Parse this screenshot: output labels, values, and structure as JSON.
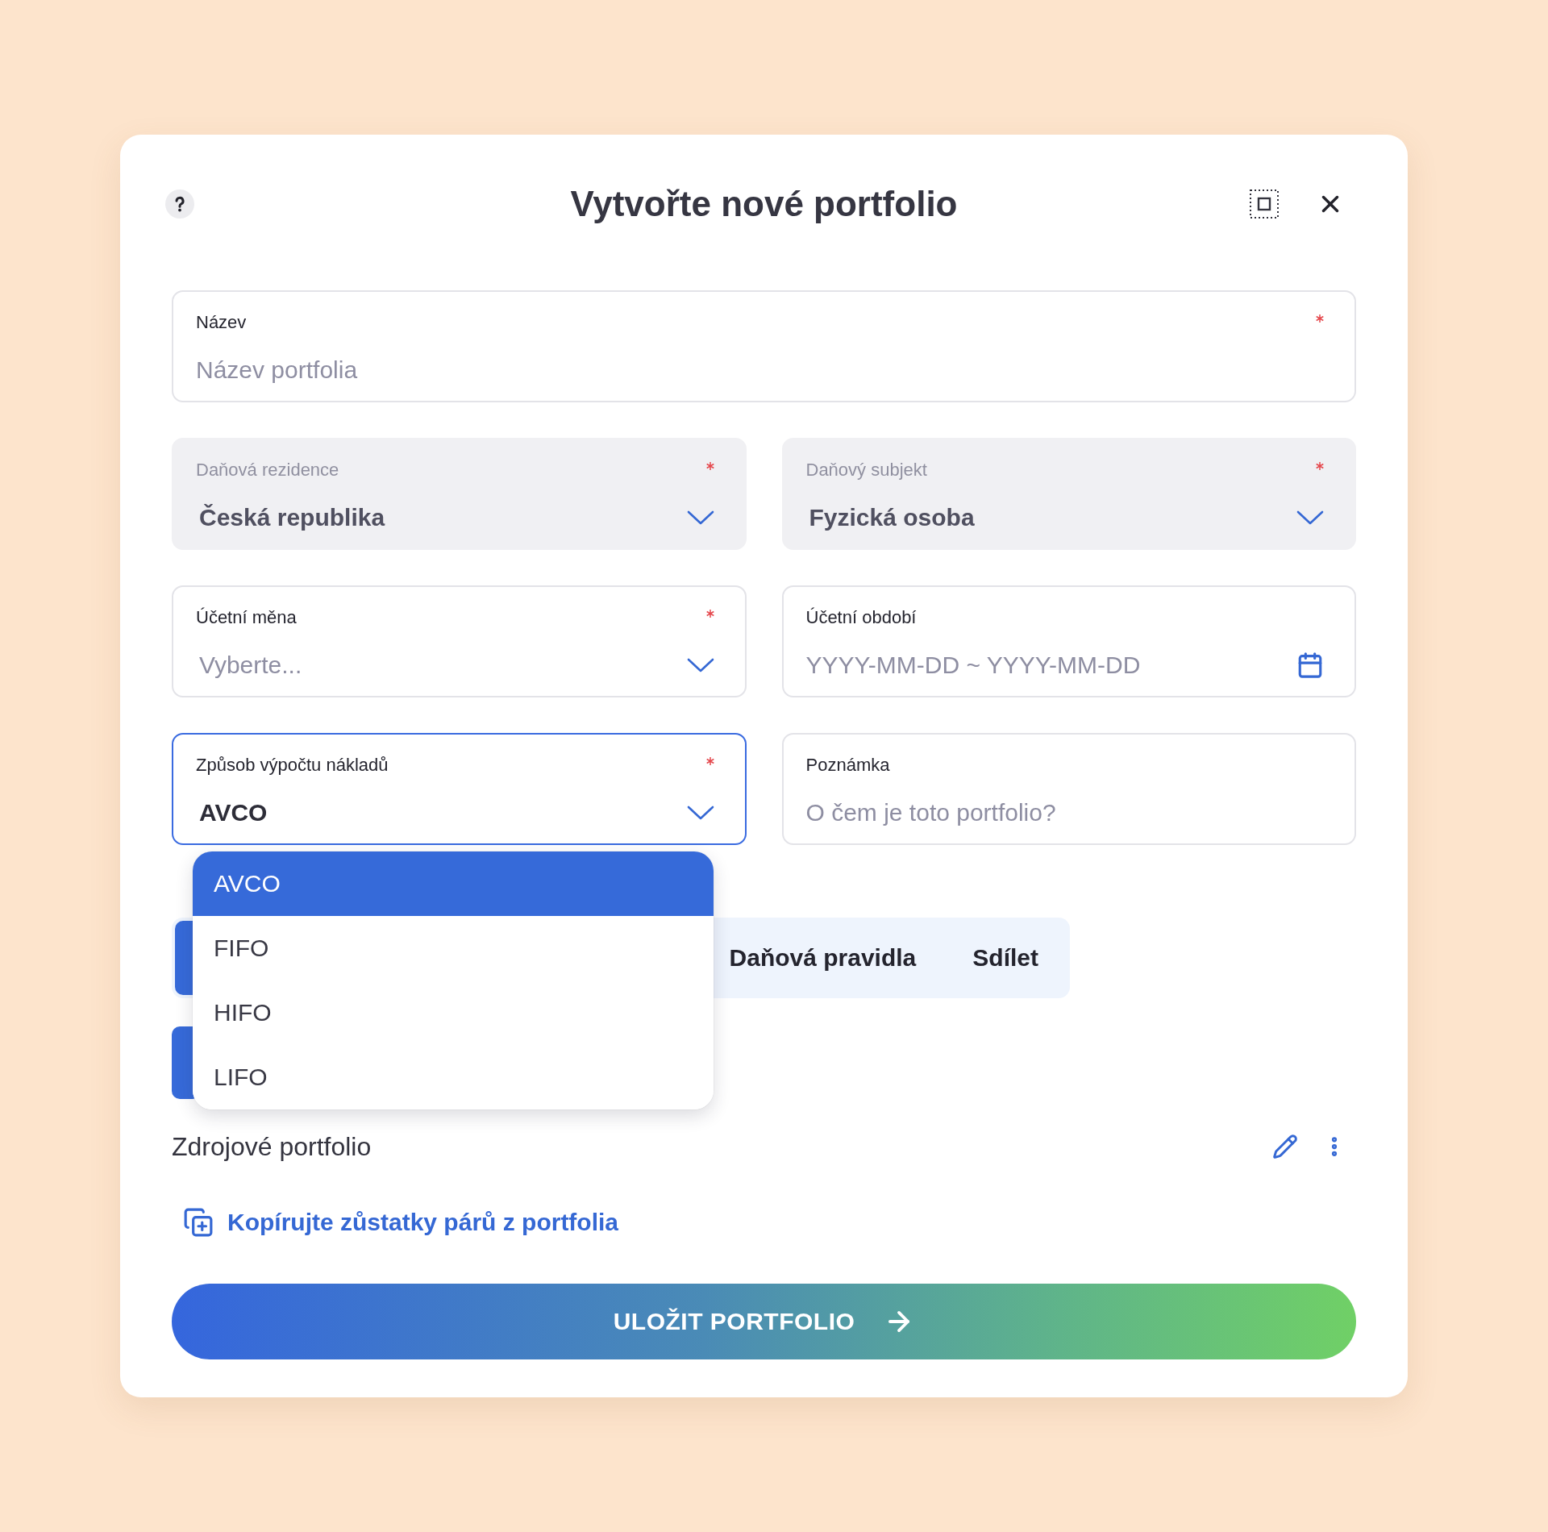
{
  "dialog": {
    "title": "Vytvořte nové portfolio"
  },
  "field_rows": [
    [
      {
        "kind": "text",
        "label": "Název",
        "placeholder": "Název portfolia",
        "required": true,
        "disabled": false,
        "focused": false
      }
    ],
    [
      {
        "kind": "select",
        "label": "Daňová rezidence",
        "value": "Česká republika",
        "required": true,
        "disabled": true,
        "focused": false,
        "expanded": false
      },
      {
        "kind": "select",
        "label": "Daňový subjekt",
        "value": "Fyzická osoba",
        "required": true,
        "disabled": true,
        "focused": false,
        "expanded": false
      }
    ],
    [
      {
        "kind": "select",
        "label": "Účetní měna",
        "placeholder": "Vyberte...",
        "required": true,
        "disabled": false,
        "focused": false,
        "expanded": false
      },
      {
        "kind": "date_range",
        "label": "Účetní období",
        "placeholder": "YYYY-MM-DD ~ YYYY-MM-DD",
        "required": false,
        "disabled": false,
        "focused": false
      }
    ],
    [
      {
        "kind": "select",
        "label": "Způsob výpočtu nákladů",
        "value": "AVCO",
        "required": true,
        "disabled": false,
        "focused": true,
        "expanded": true,
        "options": [
          {
            "label": "AVCO",
            "selected": true
          },
          {
            "label": "FIFO",
            "selected": false
          },
          {
            "label": "HIFO",
            "selected": false
          },
          {
            "label": "LIFO",
            "selected": false
          }
        ]
      },
      {
        "kind": "text",
        "label": "Poznámka",
        "placeholder": "O čem je toto portfolio?",
        "required": false,
        "disabled": false,
        "focused": false
      }
    ]
  ],
  "tabs": [
    {
      "selected": true
    },
    {
      "label": "Daňová pravidla",
      "selected": false
    },
    {
      "label": "Sdílet",
      "selected": false
    }
  ],
  "source_portfolio": {
    "title": "Zdrojové portfolio"
  },
  "copy_link": {
    "label": "Kopírujte zůstatky párů z portfolia"
  },
  "save_button": {
    "label": "ULOŽIT PORTFOLIO"
  }
}
